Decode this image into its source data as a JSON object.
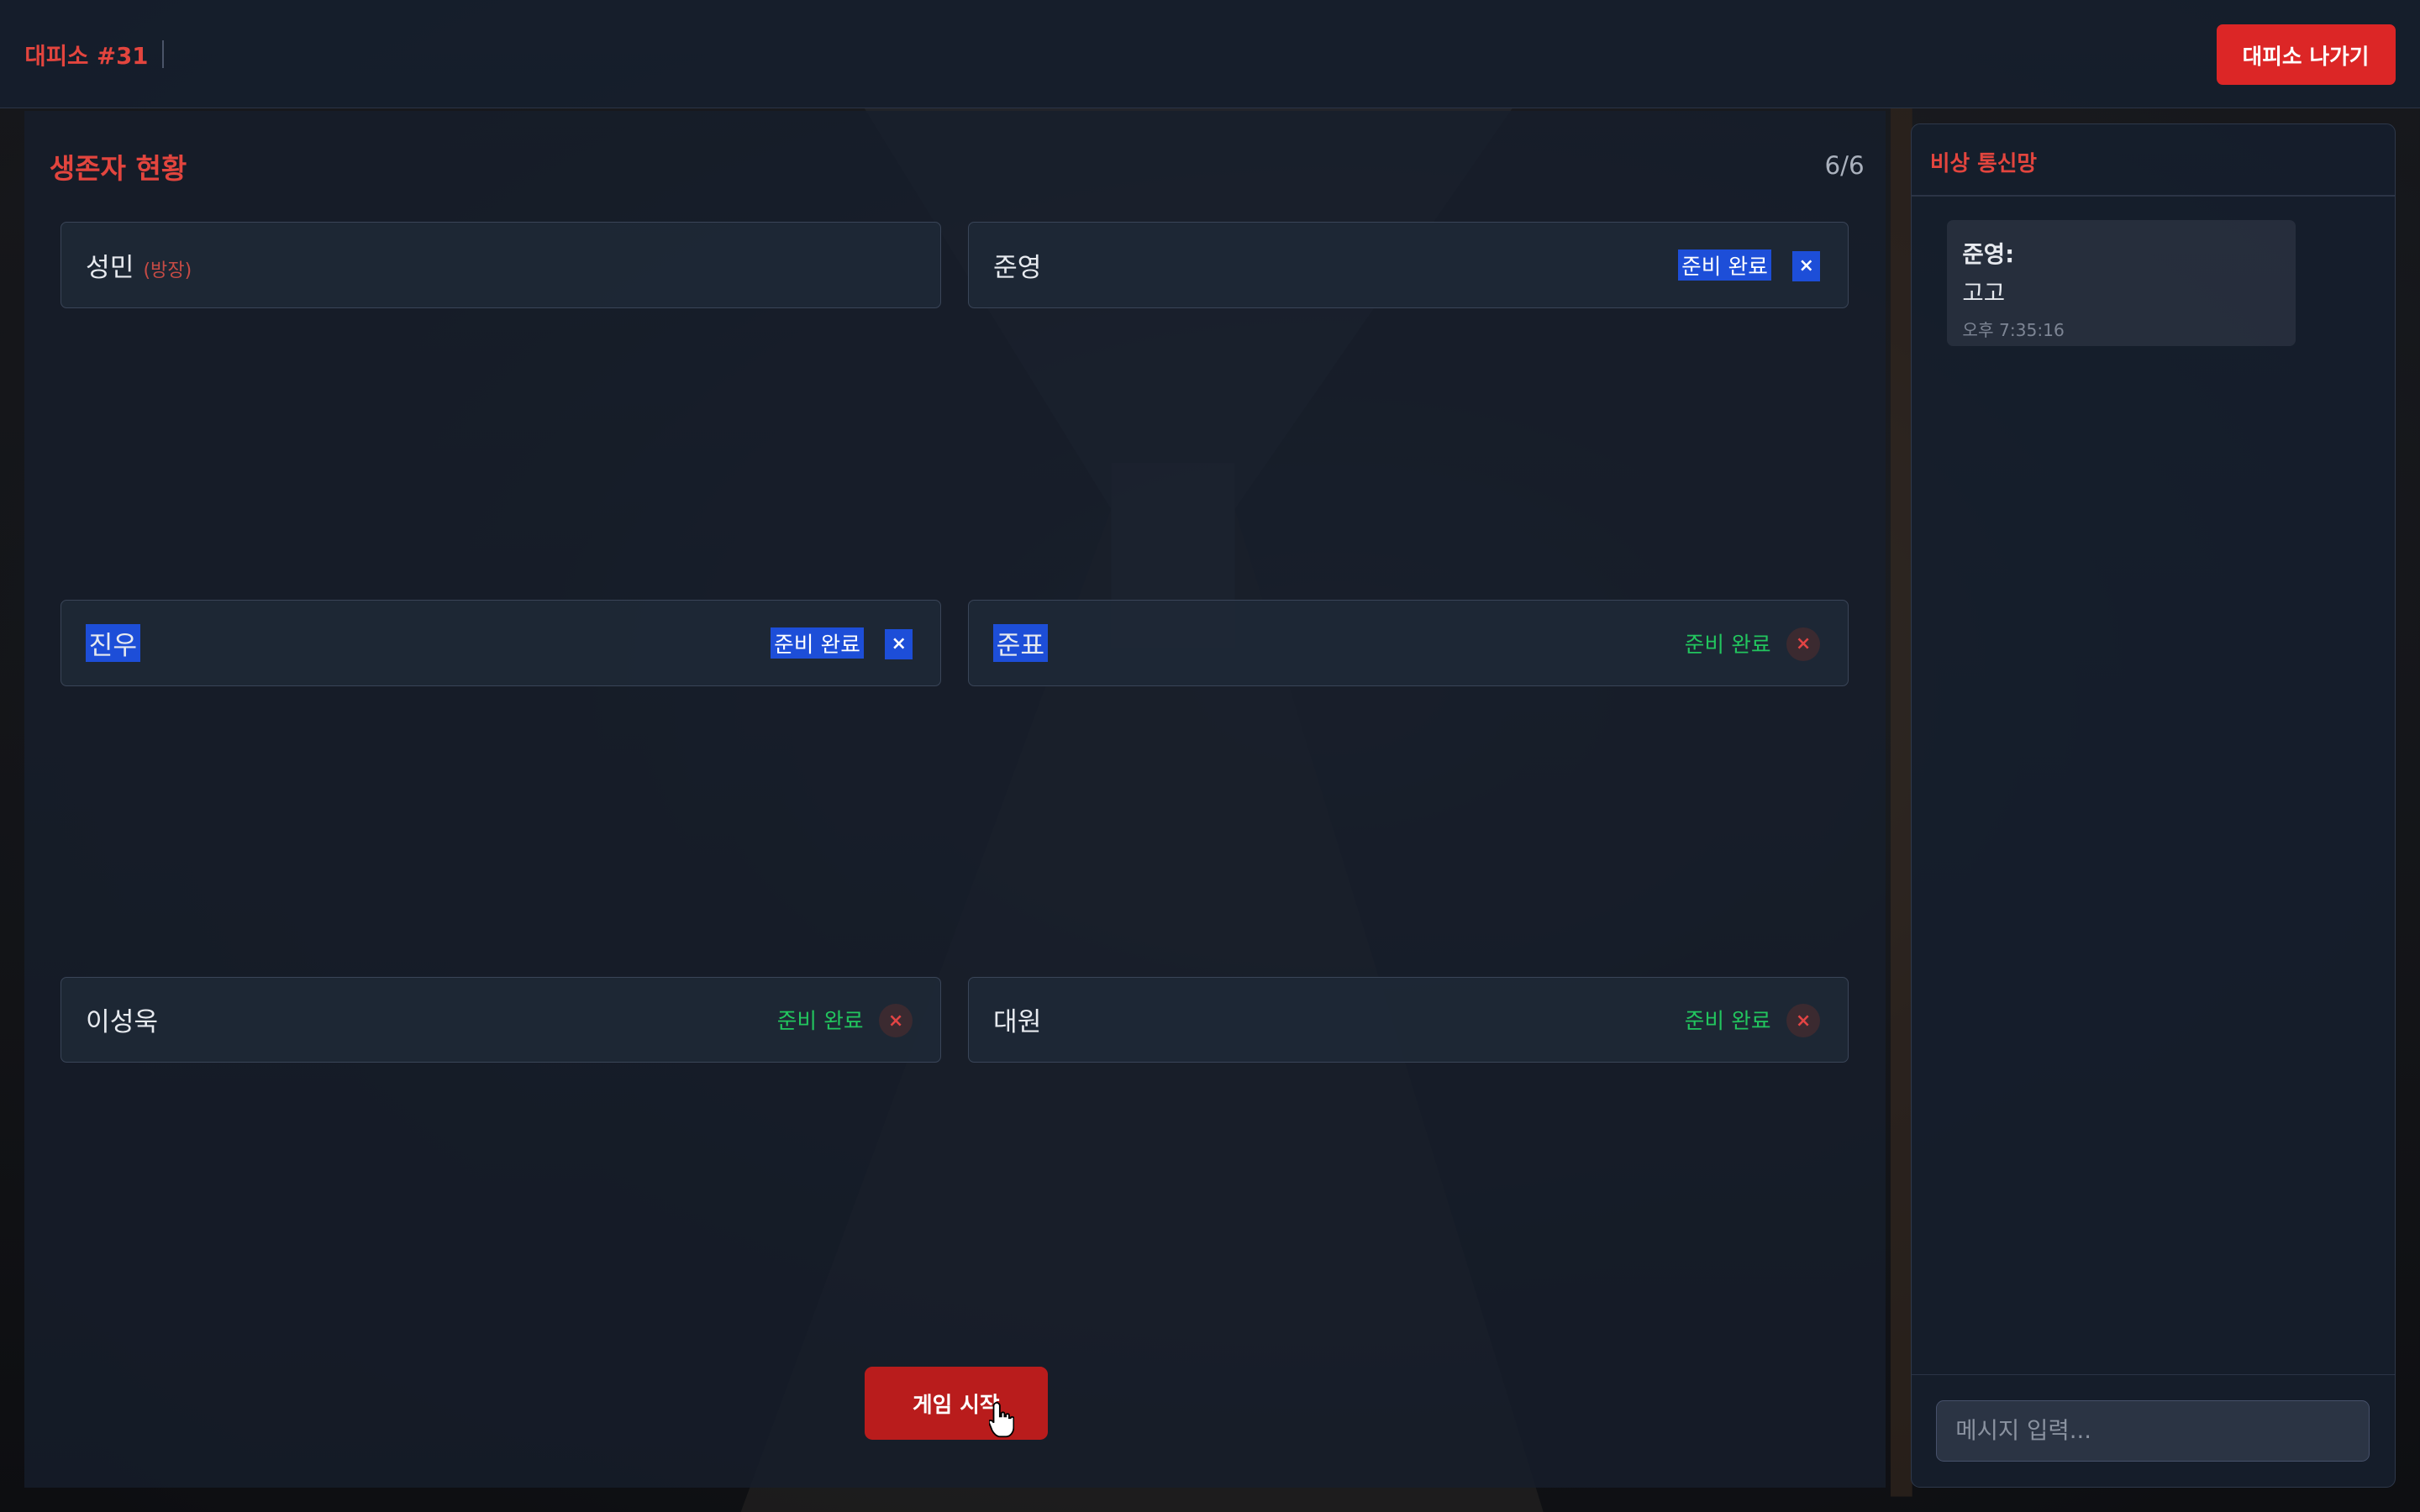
{
  "header": {
    "room_title": "대피소 #31",
    "leave_label": "대피소 나가기"
  },
  "survivors": {
    "title": "생존자 현황",
    "count": "6/6",
    "players": [
      {
        "name": "성민",
        "host_tag": "(방장)"
      },
      {
        "name": "준영",
        "status": "준비 완료",
        "kick": "×"
      },
      {
        "name": "진우",
        "status": "준비 완료",
        "kick": "×"
      },
      {
        "name": "준표",
        "status": "준비 완료",
        "kick": "×"
      },
      {
        "name": "이성욱",
        "status": "준비 완료",
        "kick": "×"
      },
      {
        "name": "대원",
        "status": "준비 완료",
        "kick": "×"
      }
    ],
    "start_label": "게임 시작"
  },
  "chat": {
    "title": "비상 통신망",
    "messages": [
      {
        "sender": "준영:",
        "text": "고고",
        "time": "오후 7:35:16"
      }
    ],
    "input_placeholder": "메시지 입력..."
  },
  "colors": {
    "accent": "#dc2626",
    "ready": "#22c55e",
    "panel": "#161e2c"
  }
}
